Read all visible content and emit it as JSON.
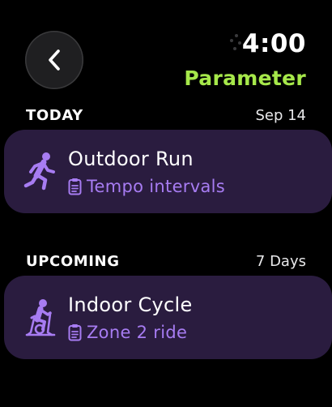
{
  "colors": {
    "accent_green": "#a6e84a",
    "accent_purple": "#a77cf2",
    "card_bg": "#2a1c3f"
  },
  "status_bar": {
    "time": "4:00",
    "app_title": "Parameter"
  },
  "sections": [
    {
      "title": "TODAY",
      "meta": "Sep 14",
      "workout": {
        "name": "Outdoor Run",
        "plan": "Tempo intervals",
        "icon": "running-figure-icon"
      }
    },
    {
      "title": "UPCOMING",
      "meta": "7 Days",
      "workout": {
        "name": "Indoor Cycle",
        "plan": "Zone 2 ride",
        "icon": "indoor-cycle-icon"
      }
    }
  ]
}
